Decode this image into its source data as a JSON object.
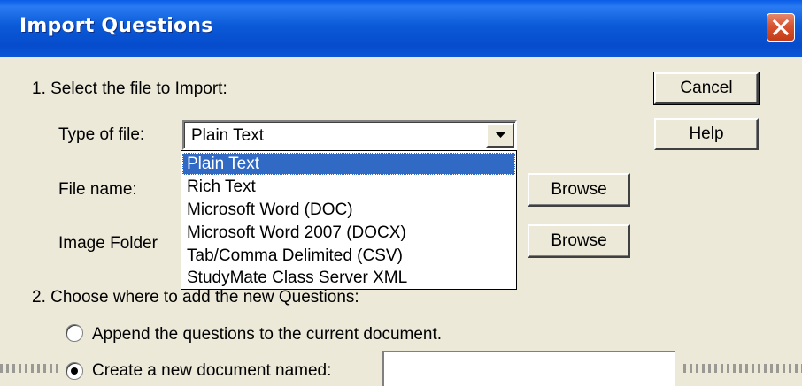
{
  "window": {
    "title": "Import Questions"
  },
  "buttons": {
    "cancel": "Cancel",
    "help": "Help",
    "browse1": "Browse",
    "browse2": "Browse"
  },
  "step1": {
    "label": "1.  Select the file to Import:",
    "type_label": "Type of file:",
    "type_value": "Plain Text",
    "file_label": "File name:",
    "image_label": "Image Folder"
  },
  "dropdown": {
    "options": [
      "Plain Text",
      "Rich Text",
      "Microsoft Word (DOC)",
      "Microsoft Word 2007 (DOCX)",
      "Tab/Comma Delimited (CSV)",
      "StudyMate Class Server XML"
    ],
    "selected_index": 0
  },
  "step2": {
    "label": "2.  Choose where to add the new Questions:",
    "append_label": "Append the questions to the current document.",
    "create_label": "Create a new document named:"
  },
  "icons": {
    "close": "close-icon",
    "dropdown_arrow": "chevron-down-icon"
  }
}
